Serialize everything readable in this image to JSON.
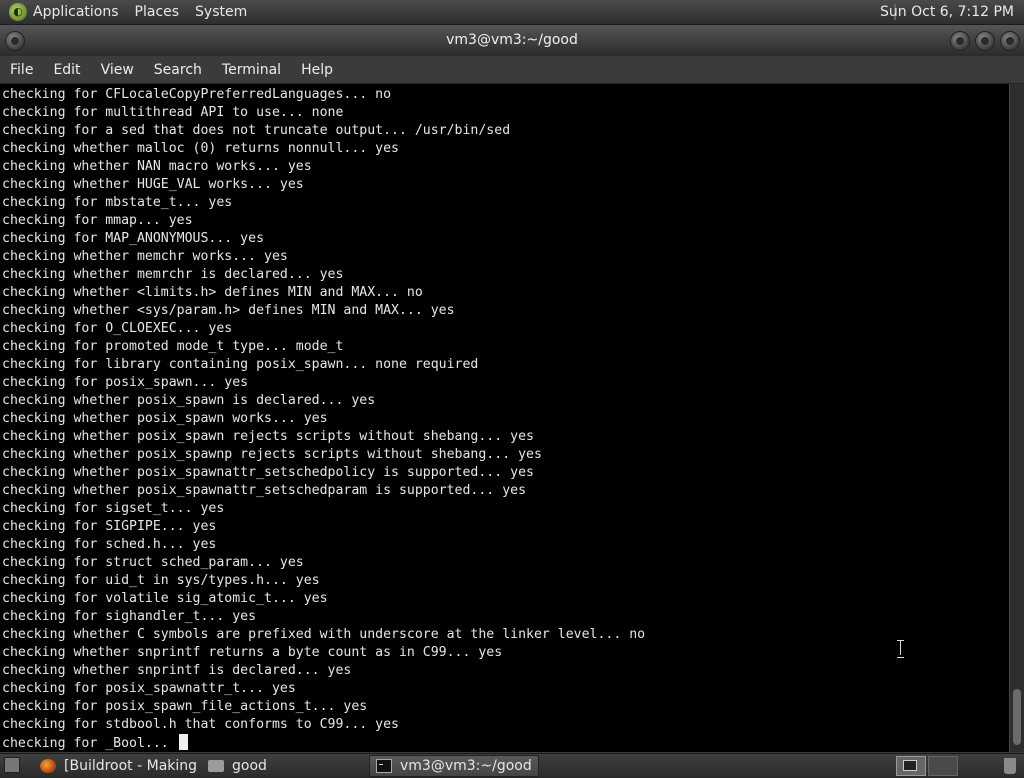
{
  "top_panel": {
    "menus": [
      "Applications",
      "Places",
      "System"
    ],
    "clock": "Sun Oct  6,  7:12 PM"
  },
  "window": {
    "title": "vm3@vm3:~/good"
  },
  "menubar": [
    "File",
    "Edit",
    "View",
    "Search",
    "Terminal",
    "Help"
  ],
  "terminal": {
    "lines": [
      "checking for CFLocaleCopyPreferredLanguages... no",
      "checking for multithread API to use... none",
      "checking for a sed that does not truncate output... /usr/bin/sed",
      "checking whether malloc (0) returns nonnull... yes",
      "checking whether NAN macro works... yes",
      "checking whether HUGE_VAL works... yes",
      "checking for mbstate_t... yes",
      "checking for mmap... yes",
      "checking for MAP_ANONYMOUS... yes",
      "checking whether memchr works... yes",
      "checking whether memrchr is declared... yes",
      "checking whether <limits.h> defines MIN and MAX... no",
      "checking whether <sys/param.h> defines MIN and MAX... yes",
      "checking for O_CLOEXEC... yes",
      "checking for promoted mode_t type... mode_t",
      "checking for library containing posix_spawn... none required",
      "checking for posix_spawn... yes",
      "checking whether posix_spawn is declared... yes",
      "checking whether posix_spawn works... yes",
      "checking whether posix_spawn rejects scripts without shebang... yes",
      "checking whether posix_spawnp rejects scripts without shebang... yes",
      "checking whether posix_spawnattr_setschedpolicy is supported... yes",
      "checking whether posix_spawnattr_setschedparam is supported... yes",
      "checking for sigset_t... yes",
      "checking for SIGPIPE... yes",
      "checking for sched.h... yes",
      "checking for struct sched_param... yes",
      "checking for uid_t in sys/types.h... yes",
      "checking for volatile sig_atomic_t... yes",
      "checking for sighandler_t... yes",
      "checking whether C symbols are prefixed with underscore at the linker level... no",
      "checking whether snprintf returns a byte count as in C99... yes",
      "checking whether snprintf is declared... yes",
      "checking for posix_spawnattr_t... yes",
      "checking for posix_spawn_file_actions_t... yes",
      "checking for stdbool.h that conforms to C99... yes",
      "checking for _Bool... "
    ]
  },
  "taskbar": {
    "tasks": [
      "[Buildroot - Making ...",
      "good",
      "vm3@vm3:~/good"
    ]
  }
}
